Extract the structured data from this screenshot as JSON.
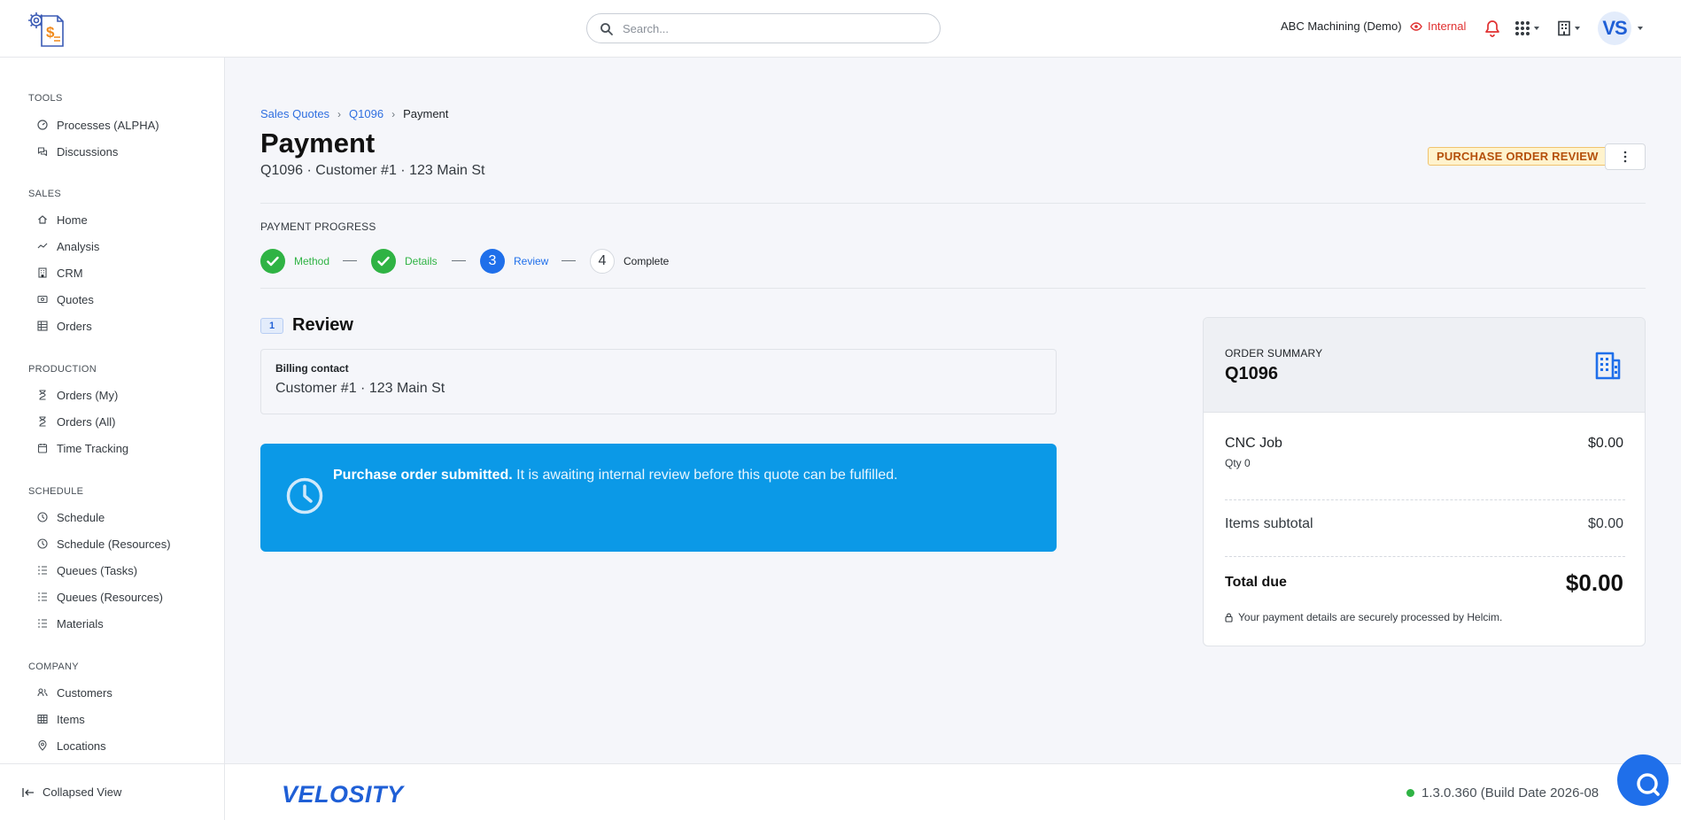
{
  "header": {
    "search_placeholder": "Search...",
    "company": "ABC Machining (Demo)",
    "visibility": "Internal",
    "avatar_initials": "VS"
  },
  "sidebar": {
    "sections": [
      {
        "title": "TOOLS",
        "items": [
          "Processes (ALPHA)",
          "Discussions"
        ]
      },
      {
        "title": "SALES",
        "items": [
          "Home",
          "Analysis",
          "CRM",
          "Quotes",
          "Orders"
        ]
      },
      {
        "title": "PRODUCTION",
        "items": [
          "Orders (My)",
          "Orders (All)",
          "Time Tracking"
        ]
      },
      {
        "title": "SCHEDULE",
        "items": [
          "Schedule",
          "Schedule (Resources)",
          "Queues (Tasks)",
          "Queues (Resources)",
          "Materials"
        ]
      },
      {
        "title": "COMPANY",
        "items": [
          "Customers",
          "Items",
          "Locations"
        ]
      }
    ],
    "collapse_label": "Collapsed View"
  },
  "breadcrumb": [
    "Sales Quotes",
    "Q1096",
    "Payment"
  ],
  "page": {
    "title": "Payment",
    "subtitle": "Q1096 · Customer #1 · 123 Main St",
    "status_badge": "PURCHASE ORDER REVIEW"
  },
  "progress": {
    "title": "PAYMENT PROGRESS",
    "steps": [
      {
        "label": "Method",
        "number": "1",
        "state": "done"
      },
      {
        "label": "Details",
        "number": "2",
        "state": "done"
      },
      {
        "label": "Review",
        "number": "3",
        "state": "active"
      },
      {
        "label": "Complete",
        "number": "4",
        "state": "todo"
      }
    ]
  },
  "review": {
    "number": "1",
    "title": "Review",
    "billing_label": "Billing contact",
    "billing_value": "Customer #1 · 123 Main St"
  },
  "alert": {
    "bold": "Purchase order submitted.",
    "text": " It is awaiting internal review before this quote can be fulfilled."
  },
  "summary": {
    "label": "ORDER SUMMARY",
    "id": "Q1096",
    "line_item": {
      "name": "CNC Job",
      "qty": "Qty 0",
      "price": "$0.00"
    },
    "subtotal_label": "Items subtotal",
    "subtotal_value": "$0.00",
    "total_label": "Total due",
    "total_value": "$0.00",
    "secure_note": "Your payment details are securely processed by Helcim."
  },
  "footer": {
    "brand": "VELOSITY",
    "version": "1.3.0.360 (Build Date 2026-08"
  },
  "colors": {
    "primary": "#1f6fea",
    "success": "#2fb344",
    "alert_bg": "#0b99e7",
    "badge_bg": "#fff3cd",
    "badge_text": "#b5500b",
    "danger": "#e03131"
  }
}
